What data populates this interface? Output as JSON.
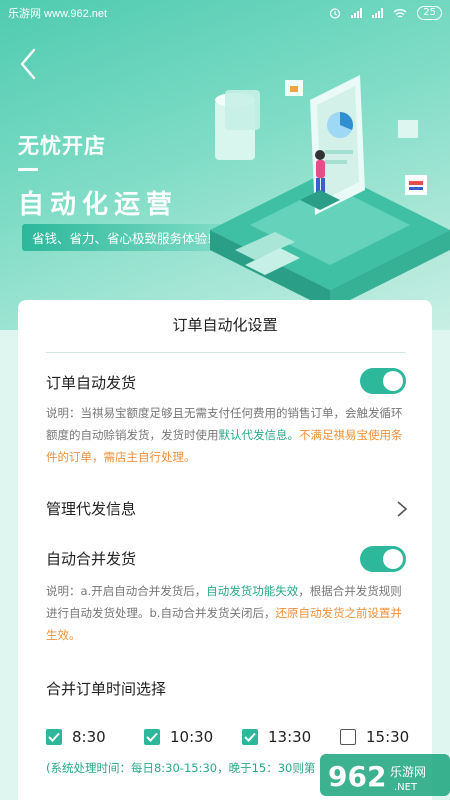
{
  "statusbar": {
    "watermark": "乐游网 www.962.net",
    "battery": "25"
  },
  "hero": {
    "title": "无忧开店",
    "main": "自动化运营",
    "tagline": "省钱、省力、省心极致服务体验!"
  },
  "card": {
    "title": "订单自动化设置",
    "auto_ship": {
      "label": "订单自动发货",
      "enabled": true,
      "desc_1": "说明：当祺易宝额度足够且无需支付任何费用的销售订单，会触发循环额度的自动赊销发货，发货时使用",
      "desc_link": "默认代发信息。",
      "desc_warn": "不满足祺易宝使用条件的订单，需店主自行处理。"
    },
    "manage": {
      "label": "管理代发信息"
    },
    "merge_ship": {
      "label": "自动合并发货",
      "enabled": true,
      "desc_1": "说明：a.开启自动合并发货后，",
      "desc_link": "自动发货功能失效",
      "desc_2": "，根据合并发货规则进行自动发货处理。b.自动合并发货关闭后，",
      "desc_warn": "还原自动发货之前设置并生效。"
    },
    "merge_time": {
      "label": "合并订单时间选择",
      "options": [
        {
          "label": "8:30",
          "checked": true
        },
        {
          "label": "10:30",
          "checked": true
        },
        {
          "label": "13:30",
          "checked": true
        },
        {
          "label": "15:30",
          "checked": false
        }
      ],
      "note": "(系统处理时间：每日8:30-15:30，晚于15：30则第"
    }
  },
  "colors": {
    "accent": "#2db89b",
    "link_green": "#2aa888",
    "warn_orange": "#f0913a"
  },
  "watermark_logo": "962 乐游网 .NET"
}
